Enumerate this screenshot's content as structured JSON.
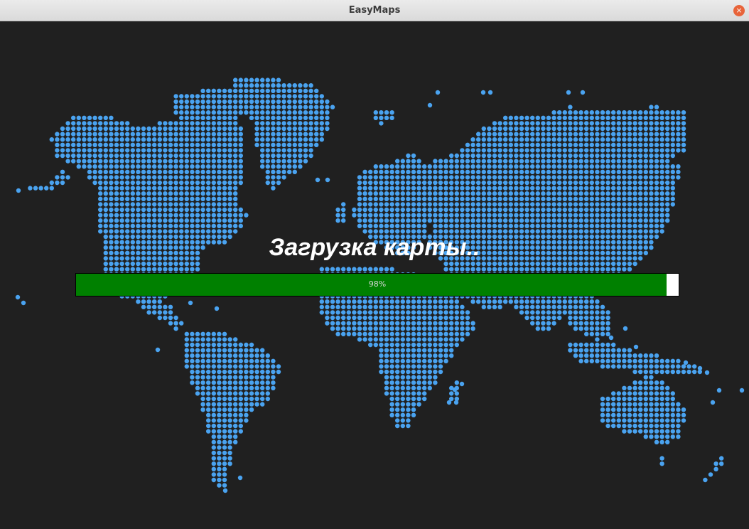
{
  "window": {
    "title": "EasyMaps",
    "close_icon": "×"
  },
  "loading": {
    "title": "Загрузка карты..",
    "progress_value": 0.98,
    "progress_label": "98%"
  },
  "colors": {
    "background": "#202020",
    "dot": "#4aa3f0",
    "progress_fill": "#008000",
    "progress_track": "#ffffff"
  }
}
